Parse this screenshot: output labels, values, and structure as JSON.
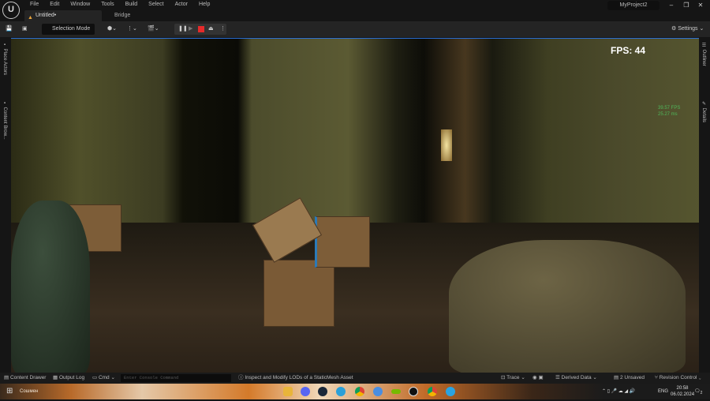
{
  "titlebar": {
    "logo": "U",
    "menu": [
      "File",
      "Edit",
      "Window",
      "Tools",
      "Build",
      "Select",
      "Actor",
      "Help"
    ],
    "tabs": [
      {
        "label": "Untitled•",
        "active": true
      },
      {
        "label": "Bridge",
        "active": false
      }
    ],
    "project": "MyProject2",
    "window_buttons": [
      "minimize",
      "restore",
      "close"
    ]
  },
  "toolbar": {
    "mode": "Selection Mode",
    "settings": "Settings",
    "play_controls": [
      "pause",
      "skip-frame",
      "stop",
      "eject",
      "more"
    ],
    "stop_color": "#e52a2a"
  },
  "viewport": {
    "fps": "FPS: 44",
    "stat_fps": "39.57 FPS",
    "stat_ms": "25.27 ms"
  },
  "left_panel": {
    "items": [
      "Place Actors",
      "Content Brow..."
    ]
  },
  "right_panel": {
    "items": [
      "Outliner",
      "Details"
    ]
  },
  "statusbar": {
    "content_drawer": "Content Drawer",
    "output_log": "Output Log",
    "cmd": "Cmd",
    "console_placeholder": "Enter Console Command",
    "hint": "Inspect and Modify LODs of a StaticMesh Asset",
    "trace": "Trace",
    "derived_data": "Derived Data",
    "unsaved": "2 Unsaved",
    "revision_control": "Revision Control"
  },
  "taskbar": {
    "search": "Сошмен",
    "apps": [
      "file-explorer",
      "discord",
      "steam",
      "edge",
      "chrome",
      "app",
      "nvidia",
      "unreal-engine",
      "chrome-alt",
      "telegram"
    ],
    "language": "ENG",
    "time": "20:58",
    "date": "06.02.2024",
    "notifications": "2"
  }
}
